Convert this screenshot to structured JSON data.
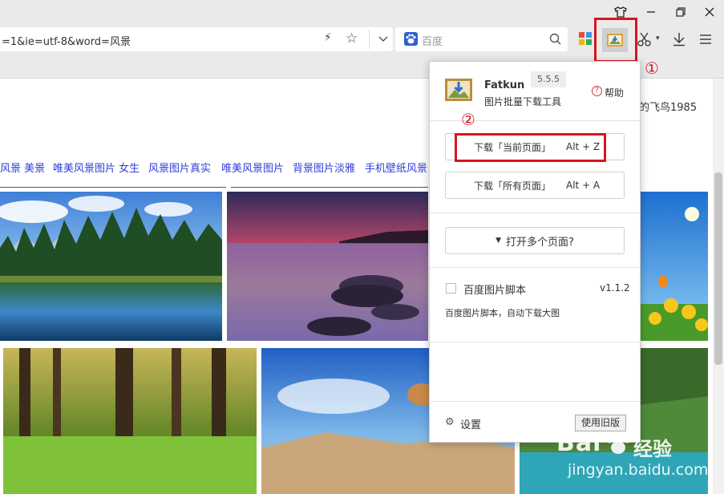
{
  "browser": {
    "address_text": "=1&ie=utf-8&word=风景",
    "search_placeholder": "百度",
    "window_buttons": [
      "shirt-icon",
      "minimize-icon",
      "restore-icon",
      "close-icon"
    ]
  },
  "page": {
    "snippet_text": "的飞鸟1985",
    "tags": [
      "风景 美景",
      "唯美风景图片 女生",
      "风景图片真实",
      "唯美风景图片",
      "背景图片淡雅",
      "手机壁纸风景"
    ]
  },
  "popup": {
    "app_name": "Fatkun",
    "version": "5.5.5",
    "subtitle": "图片批量下载工具",
    "help_label": "帮助",
    "download_current_label": "下载「当前页面」",
    "download_current_shortcut": "Alt + Z",
    "download_all_label": "下载「所有页面」",
    "download_all_shortcut": "Alt + A",
    "open_multiple_label": "打开多个页面?",
    "script_name": "百度图片脚本",
    "script_version": "v1.1.2",
    "script_desc": "百度图片脚本，自动下载大图",
    "settings_label": "设置",
    "old_version_label": "使用旧版"
  },
  "annotations": {
    "marker_1": "①",
    "marker_2": "②",
    "highlight_color": "#d9141e"
  },
  "watermark": {
    "brand": "Bai",
    "brand_suffix": "经验",
    "url": "jingyan.baidu.com"
  }
}
